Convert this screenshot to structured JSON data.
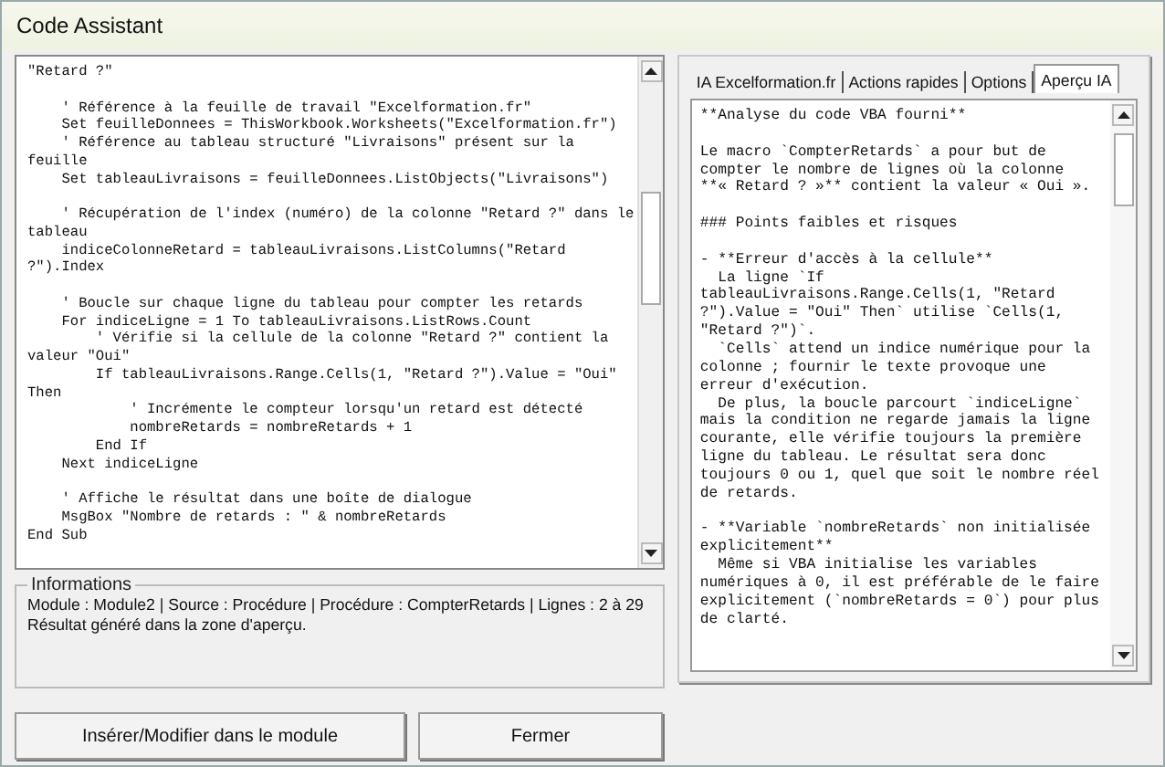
{
  "window": {
    "title": "Code Assistant"
  },
  "code_text": "\"Retard ?\"\n\n    ' Référence à la feuille de travail \"Excelformation.fr\"\n    Set feuilleDonnees = ThisWorkbook.Worksheets(\"Excelformation.fr\")\n    ' Référence au tableau structuré \"Livraisons\" présent sur la\nfeuille\n    Set tableauLivraisons = feuilleDonnees.ListObjects(\"Livraisons\")\n\n    ' Récupération de l'index (numéro) de la colonne \"Retard ?\" dans le\ntableau\n    indiceColonneRetard = tableauLivraisons.ListColumns(\"Retard\n?\").Index\n\n    ' Boucle sur chaque ligne du tableau pour compter les retards\n    For indiceLigne = 1 To tableauLivraisons.ListRows.Count\n        ' Vérifie si la cellule de la colonne \"Retard ?\" contient la\nvaleur \"Oui\"\n        If tableauLivraisons.Range.Cells(1, \"Retard ?\").Value = \"Oui\"\nThen\n            ' Incrémente le compteur lorsqu'un retard est détecté\n            nombreRetards = nombreRetards + 1\n        End If\n    Next indiceLigne\n\n    ' Affiche le résultat dans une boîte de dialogue\n    MsgBox \"Nombre de retards : \" & nombreRetards\nEnd Sub",
  "info": {
    "title": "Informations",
    "lines": [
      "Module : Module2 | Source : Procédure | Procédure : CompterRetards | Lignes : 2 à 29",
      "Résultat généré dans la zone d'aperçu."
    ]
  },
  "buttons": [
    "Insérer/Modifier dans le module",
    "Fermer"
  ],
  "tabs": [
    {
      "label": "IA Excelformation.fr",
      "selected": false
    },
    {
      "label": "Actions rapides",
      "selected": false
    },
    {
      "label": "Options",
      "selected": false
    },
    {
      "label": "Aperçu IA",
      "selected": true
    }
  ],
  "preview_text": "**Analyse du code VBA fourni**\n\nLe macro `CompterRetards` a pour but de\ncompter le nombre de lignes où la colonne\n**« Retard ? »** contient la valeur « Oui ».\n\n### Points faibles et risques\n\n- **Erreur d'accès à la cellule**\n  La ligne `If\ntableauLivraisons.Range.Cells(1, \"Retard\n?\").Value = \"Oui\" Then` utilise `Cells(1,\n\"Retard ?\")`.\n  `Cells` attend un indice numérique pour la\ncolonne ; fournir le texte provoque une\nerreur d'exécution.\n  De plus, la boucle parcourt `indiceLigne`\nmais la condition ne regarde jamais la ligne\ncourante, elle vérifie toujours la première\nligne du tableau. Le résultat sera donc\ntoujours 0 ou 1, quel que soit le nombre réel\nde retards.\n\n- **Variable `nombreRetards` non initialisée\nexplicitement**\n  Même si VBA initialise les variables\nnumériques à 0, il est préférable de le faire\nexplicitement (`nombreRetards = 0`) pour plus\nde clarté."
}
